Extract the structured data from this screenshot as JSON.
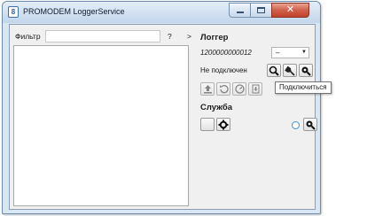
{
  "window": {
    "title": "PROMODEM LoggerService",
    "icon_glyph": "8"
  },
  "left": {
    "filter_label": "Фильтр",
    "filter_value": "",
    "help_label": "?",
    "expand_label": ">"
  },
  "logger": {
    "title": "Логгер",
    "serial": "1200000000012",
    "combo_value": "–",
    "status": "Не подключен",
    "tooltip": "Подключиться"
  },
  "service": {
    "title": "Служба"
  },
  "icons": {
    "search": "search-icon",
    "disconnect": "plug-icon",
    "connect": "connect-icon",
    "upload": "upload-icon",
    "reset": "reset-icon",
    "gauge": "gauge-icon",
    "download": "download-icon",
    "gear": "gear-icon"
  }
}
